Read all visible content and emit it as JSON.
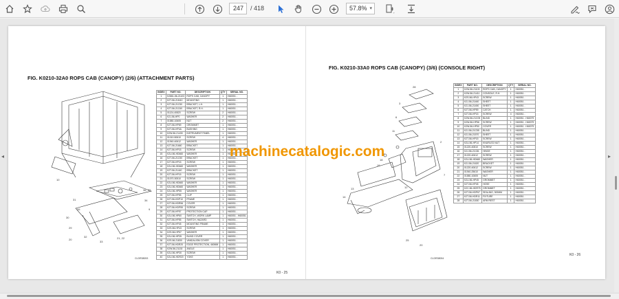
{
  "toolbar": {
    "page_current": "247",
    "page_total": "/ 418",
    "zoom": "57.8%",
    "icons": [
      "home-icon",
      "bookmark-icon",
      "upload-icon",
      "print-icon",
      "zoom-search-icon",
      "page-up-icon",
      "page-down-icon",
      "cursor-icon",
      "hand-icon",
      "zoom-out-icon",
      "zoom-in-icon",
      "fit-page-icon",
      "download-icon",
      "edit-sign-icon",
      "comment-icon",
      "user-icon"
    ]
  },
  "left_page": {
    "title": "FIG. K0210-32A0   ROPS CAB (CANOPY) (2/6) (ATTACHMENT PARTS)",
    "headers": [
      "INDEX",
      "PART NO.",
      "DESCRIPTION",
      "QTY",
      "SERIAL NO."
    ],
    "rows": [
      [
        "1",
        "K2861-56-21103",
        "ROPS CAB, CANOPY",
        "1",
        "H60051 -"
      ],
      [
        "2",
        "K2T-56-21M10",
        "MOUNTING",
        "1",
        "H60051 -"
      ],
      [
        "3",
        "K2T-56-21C50",
        "BRACKET, L.H.",
        "1",
        "H60051 -"
      ],
      [
        "4",
        "K2T-56-21C60",
        "BRACKET, R.H.",
        "1",
        "H60051 -"
      ],
      [
        "5",
        "01124-40820",
        "SCREW",
        "2",
        "H60051 -"
      ],
      [
        "6",
        "K2J-56-HP0",
        "WASHER",
        "2",
        "H60051 -"
      ],
      [
        "7",
        "01580-10605",
        "NUT",
        "2",
        "H60051 -"
      ],
      [
        "8",
        "K2T-56-HP69",
        "GROMMET",
        "1",
        "H60051 -"
      ],
      [
        "9",
        "K2T-56-HP4A",
        "BUSHING",
        "1",
        "H60051 -"
      ],
      [
        "10",
        "K2W-56-21430",
        "INSTRUMENT PANEL",
        "1",
        "H60051 -"
      ],
      [
        "11",
        "01010-50610",
        "SCREW",
        "4",
        "H60051 -"
      ],
      [
        "12",
        "01940-40612",
        "WASHER",
        "1",
        "H60051 -"
      ],
      [
        "13",
        "K2T-56-21660",
        "BRACKET",
        "1",
        "H60051 -"
      ],
      [
        "14",
        "K2T-56-HP15",
        "SCREW",
        "1",
        "H60051 -"
      ],
      [
        "15",
        "K2U-56-HD660",
        "WASHER",
        "1",
        "H60051 -"
      ],
      [
        "16",
        "K2T-56-21C50",
        "BRACKET",
        "1",
        "H60051 -"
      ],
      [
        "17",
        "K2T-56-HP15",
        "SCREW",
        "1",
        "H60051 -"
      ],
      [
        "18",
        "K2U-56-HD660",
        "WASHER",
        "1",
        "H60051 -"
      ],
      [
        "19",
        "K2T-56-21440",
        "BRACKET",
        "1",
        "H60051 -"
      ],
      [
        "20",
        "K2T-56-HP15",
        "SCREW",
        "1",
        "H60051 -"
      ],
      [
        "21",
        "01070-30510",
        "SCREW",
        "1",
        "H60051 -"
      ],
      [
        "22",
        "K2U-56-HD660",
        "WASHER",
        "1",
        "H60051 -"
      ],
      [
        "23",
        "K2U-56-HD660",
        "WASHER",
        "1",
        "H60051 -"
      ],
      [
        "24",
        "K2U-56-HP55",
        "WASHER",
        "1",
        "H60051 -"
      ],
      [
        "25",
        "K2T-56-HP55",
        "CLIP",
        "1",
        "H60051 -"
      ],
      [
        "26",
        "K2T-56-HDP10",
        "FRAME",
        "1",
        "H60051 -"
      ],
      [
        "27",
        "K2T-56-HDR56",
        "COVER",
        "1",
        "H60051 -"
      ],
      [
        "28",
        "K2T-56-HDP55",
        "SCREW",
        "1",
        "H60051 -"
      ],
      [
        "29",
        "K2T-56-HP57",
        "PROTECTION CAP",
        "1",
        "H60051 -"
      ],
      [
        "30",
        "K2U-56-HP60",
        "SWITCH, WORK LAMP",
        "1",
        "H60051 - H60051"
      ],
      [
        "31",
        "K2T-56-HP55",
        "SWITCH, HAZARD",
        "1",
        "H60051 -"
      ],
      [
        "32",
        "K2T-56-HP45",
        "MOUNTING FRAME",
        "1",
        "H60051 -"
      ],
      [
        "33",
        "K2S-56-HP43",
        "SCREW",
        "1",
        "H60051 -"
      ],
      [
        "34",
        "K2S-56-HP57",
        "WASHER",
        "1",
        "H60051 -"
      ],
      [
        "35",
        "K2U-56-HP35",
        "BLIND COVER",
        "1",
        "H60051 -"
      ],
      [
        "36",
        "K2S-56-21830",
        "VANDALISM COVER",
        "1",
        "H60051 -"
      ],
      [
        "37",
        "K2T-56-HDR20",
        "EDGE PROTECTION, 460MM",
        "1",
        "H60051 -"
      ],
      [
        "38",
        "K2W-56-21130",
        "ANGLE",
        "1",
        "H60051 -"
      ],
      [
        "39",
        "K2U-56-HP30",
        "SCREW",
        "1",
        "H60051 -"
      ],
      [
        "40",
        "K2U-56-HDR20",
        "YOKE",
        "1",
        "H60051 -"
      ]
    ],
    "drawing_code": "CLDR38053",
    "footer": "K0 - 25"
  },
  "right_page": {
    "title": "FIG. K0210-33A0   ROPS CAB (CANOPY) (3/6) (CONSOLE RIGHT)",
    "headers": [
      "INDEX",
      "PART NO.",
      "DESCRIPTION",
      "QTY",
      "SERIAL NO."
    ],
    "rows": [
      [
        "1",
        "K2W-56-21103",
        "ROPS CAB, CANOPY",
        "1",
        "H60051 -"
      ],
      [
        "2",
        "K2W-56-21411",
        "CONSOLE, R.H.",
        "1",
        "H60051 -"
      ],
      [
        "3",
        "K2S-56-HP43",
        "SCREW",
        "1",
        "H60051 -"
      ],
      [
        "4",
        "K2J-56-21460",
        "SHEET",
        "1",
        "H60051 -"
      ],
      [
        "5",
        "K2J-56-21450",
        "SHEET",
        "1",
        "H60051 -"
      ],
      [
        "6",
        "K2T-56-HP59",
        "CATCH",
        "1",
        "H60051 -"
      ],
      [
        "7",
        "K2T-56-HP15",
        "SCREW",
        "4",
        "H60051 -"
      ],
      [
        "8",
        "K2W-56-21C05",
        "BLIND",
        "1",
        "H60051 - H60079"
      ],
      [
        "9",
        "K2W-56-HP56",
        "SCREW",
        "1",
        "H60051 - H60079"
      ],
      [
        "10",
        "K2W-56-HP50",
        "COVER",
        "1",
        "H60051 - H60079"
      ],
      [
        "11",
        "K2J-56-21C55",
        "BLIND",
        "1",
        "H60051 -"
      ],
      [
        "12",
        "K2J-56-21570",
        "SHEET",
        "1",
        "H60051 -"
      ],
      [
        "13",
        "K2T-56-HP15",
        "SCREW",
        "1",
        "H60051 -"
      ],
      [
        "14",
        "K2U-56-HP14",
        "KNURLED NUT",
        "1",
        "H60051 -"
      ],
      [
        "15",
        "01220-40810",
        "SCREW",
        "1",
        "H60051 -"
      ],
      [
        "16",
        "K2J-56-21C81",
        "HINGE",
        "1",
        "H60051 -"
      ],
      [
        "17",
        "01220-40612",
        "SCREW",
        "1",
        "H60051 -"
      ],
      [
        "18",
        "K2U-56-HD660",
        "WASHER",
        "1",
        "H60051 -"
      ],
      [
        "19",
        "K2J-56-21620",
        "BRACKET",
        "1",
        "H60051 -"
      ],
      [
        "20",
        "01220-40612",
        "SCREW",
        "1",
        "H60051 -"
      ],
      [
        "21",
        "01940-25610",
        "WASHER",
        "1",
        "H60051 -"
      ],
      [
        "22",
        "01580-10605",
        "NUT",
        "1",
        "H60051 -"
      ],
      [
        "23",
        "K2U-56-HP45",
        "GROMMET",
        "1",
        "H60051 -"
      ],
      [
        "24",
        "K2T-56-HP45",
        "HOSE",
        "1",
        "H60051 -"
      ],
      [
        "25",
        "K2C-56-HDR75",
        "GROMMET",
        "1",
        "H60051 -"
      ],
      [
        "26",
        "K2T-56-HDP67",
        "SEALING, 300MM",
        "1",
        "H60051 -"
      ],
      [
        "27",
        "K2T-56-HDR11",
        "FIXTURE",
        "1",
        "H60051 -"
      ],
      [
        "28",
        "K2T-56-21830",
        "ARM REST",
        "1",
        "H60051 -"
      ]
    ],
    "drawing_code": "CLDR38054",
    "footer": "K0 - 26"
  },
  "watermark": "machinecatalogic.com",
  "colors": {
    "accent": "#2b6fd6",
    "watermark": "#f09600"
  }
}
